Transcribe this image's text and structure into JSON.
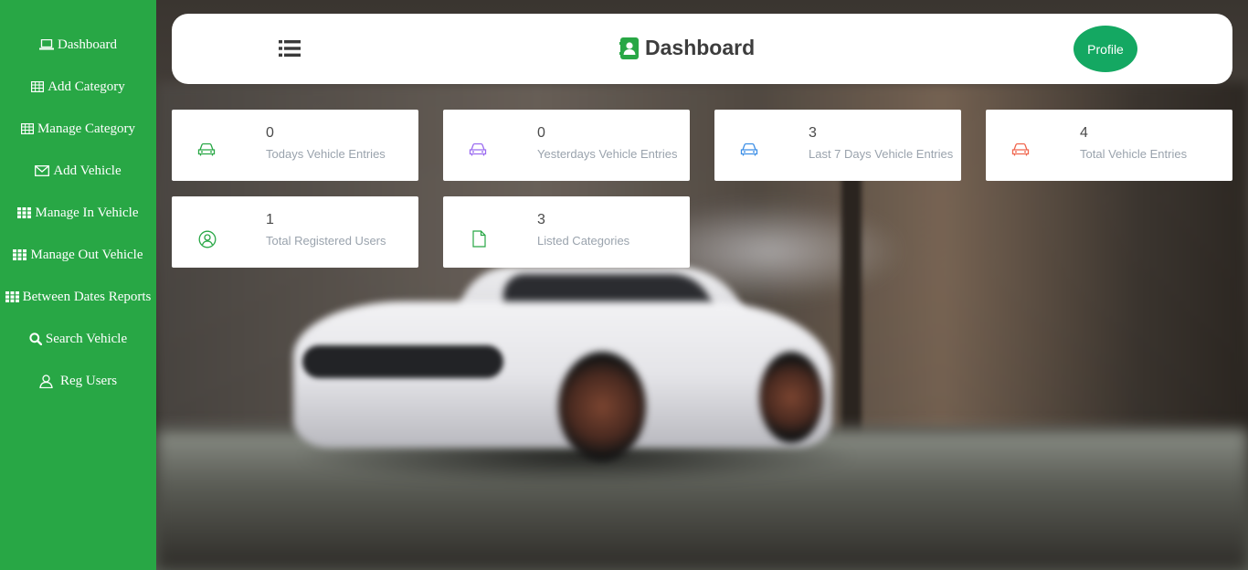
{
  "sidebar": {
    "items": [
      {
        "label": "Dashboard",
        "icon": "laptop-icon"
      },
      {
        "label": "Add Category",
        "icon": "table-icon"
      },
      {
        "label": "Manage Category",
        "icon": "table-icon"
      },
      {
        "label": "Add  Vehicle",
        "icon": "envelope-icon"
      },
      {
        "label": "Manage In Vehicle",
        "icon": "grid-icon"
      },
      {
        "label": "Manage Out Vehicle",
        "icon": "grid-icon"
      },
      {
        "label": "Between Dates Reports",
        "icon": "grid-icon"
      },
      {
        "label": "Search Vehicle",
        "icon": "search-icon"
      },
      {
        "label": "Reg  Users",
        "icon": "user-icon"
      }
    ],
    "color": "#28a745"
  },
  "header": {
    "title": "Dashboard",
    "profile_label": "Profile",
    "profile_color": "#14a862",
    "menu_icon": "list-icon",
    "logo_icon": "contact-book-icon"
  },
  "stats": [
    {
      "value": "0",
      "label": "Todays Vehicle Entries",
      "icon": "car-icon",
      "color": "#28a745"
    },
    {
      "value": "0",
      "label": "Yesterdays Vehicle Entries",
      "icon": "car-icon",
      "color": "#9b6cf0"
    },
    {
      "value": "3",
      "label": "Last 7 Days Vehicle Entries",
      "icon": "car-icon",
      "color": "#3d8fe6"
    },
    {
      "value": "4",
      "label": "Total Vehicle Entries",
      "icon": "car-icon",
      "color": "#f0654d"
    },
    {
      "value": "1",
      "label": "Total Registered Users",
      "icon": "user-circle-icon",
      "color": "#28a745"
    },
    {
      "value": "3",
      "label": "Listed Categories",
      "icon": "file-icon",
      "color": "#28a745"
    }
  ]
}
